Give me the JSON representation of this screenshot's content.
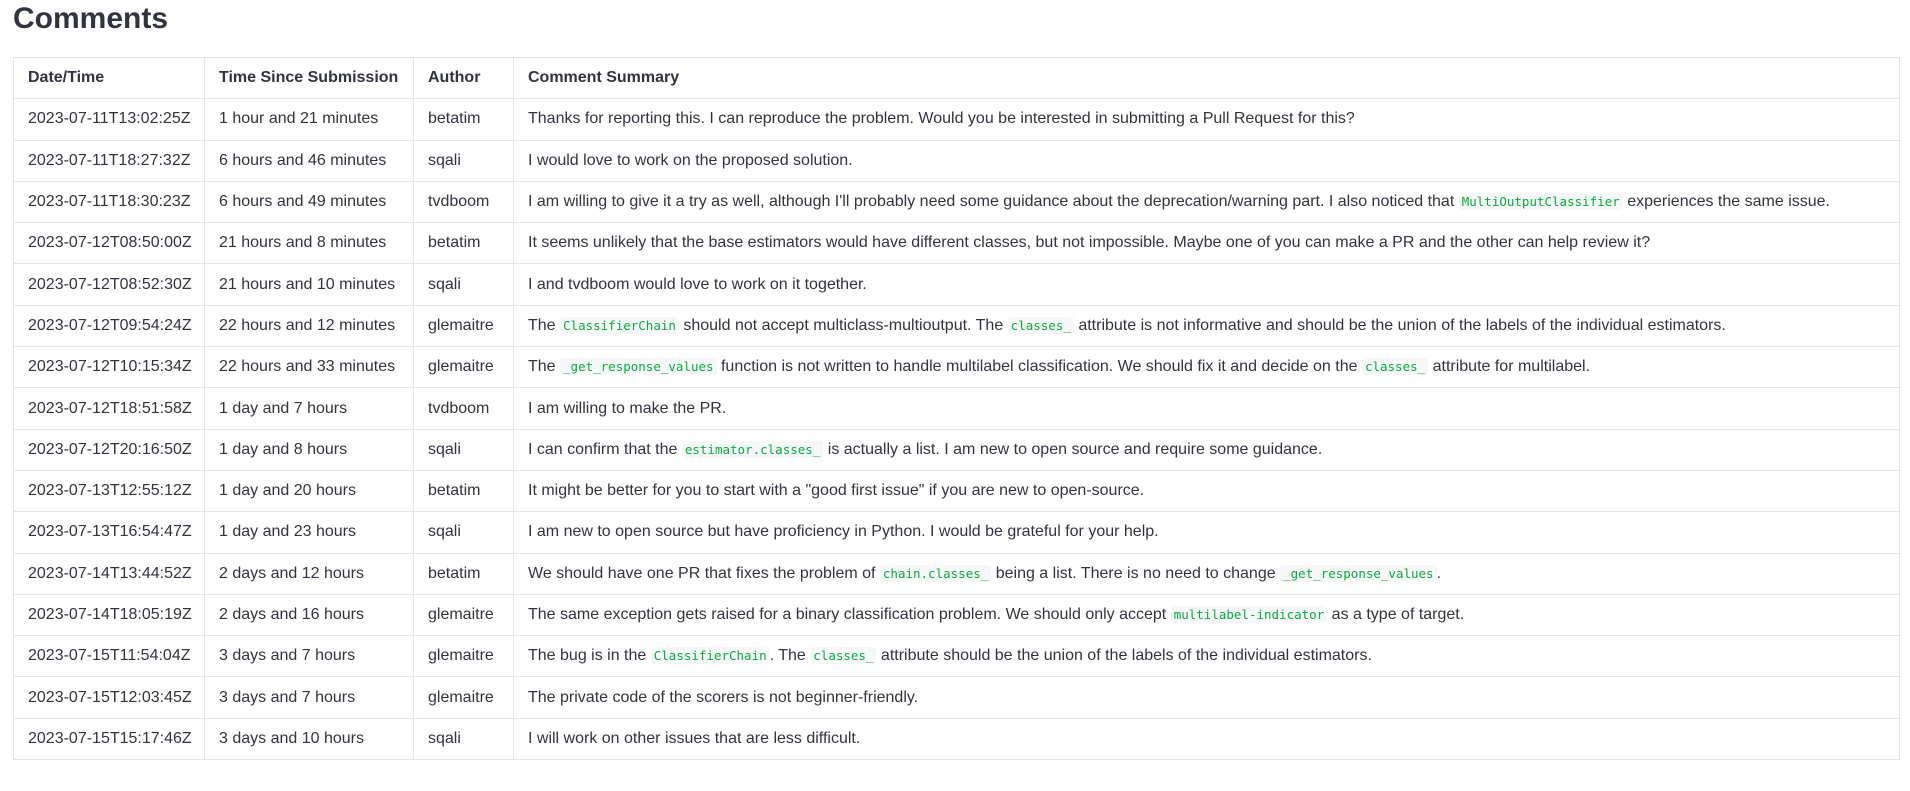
{
  "page": {
    "title": "Comments"
  },
  "table": {
    "columns": [
      "Date/Time",
      "Time Since Submission",
      "Author",
      "Comment Summary"
    ],
    "rows": [
      {
        "datetime": "2023-07-11T13:02:25Z",
        "since": "1 hour and 21 minutes",
        "author": "betatim",
        "summary": [
          {
            "t": "text",
            "v": "Thanks for reporting this. I can reproduce the problem. Would you be interested in submitting a Pull Request for this?"
          }
        ]
      },
      {
        "datetime": "2023-07-11T18:27:32Z",
        "since": "6 hours and 46 minutes",
        "author": "sqali",
        "summary": [
          {
            "t": "text",
            "v": "I would love to work on the proposed solution."
          }
        ]
      },
      {
        "datetime": "2023-07-11T18:30:23Z",
        "since": "6 hours and 49 minutes",
        "author": "tvdboom",
        "summary": [
          {
            "t": "text",
            "v": "I am willing to give it a try as well, although I'll probably need some guidance about the deprecation/warning part. I also noticed that "
          },
          {
            "t": "code",
            "v": "MultiOutputClassifier"
          },
          {
            "t": "text",
            "v": " experiences the same issue."
          }
        ]
      },
      {
        "datetime": "2023-07-12T08:50:00Z",
        "since": "21 hours and 8 minutes",
        "author": "betatim",
        "summary": [
          {
            "t": "text",
            "v": "It seems unlikely that the base estimators would have different classes, but not impossible. Maybe one of you can make a PR and the other can help review it?"
          }
        ]
      },
      {
        "datetime": "2023-07-12T08:52:30Z",
        "since": "21 hours and 10 minutes",
        "author": "sqali",
        "summary": [
          {
            "t": "text",
            "v": "I and tvdboom would love to work on it together."
          }
        ]
      },
      {
        "datetime": "2023-07-12T09:54:24Z",
        "since": "22 hours and 12 minutes",
        "author": "glemaitre",
        "summary": [
          {
            "t": "text",
            "v": "The "
          },
          {
            "t": "code",
            "v": "ClassifierChain"
          },
          {
            "t": "text",
            "v": " should not accept multiclass-multioutput. The "
          },
          {
            "t": "code",
            "v": "classes_"
          },
          {
            "t": "text",
            "v": " attribute is not informative and should be the union of the labels of the individual estimators."
          }
        ]
      },
      {
        "datetime": "2023-07-12T10:15:34Z",
        "since": "22 hours and 33 minutes",
        "author": "glemaitre",
        "summary": [
          {
            "t": "text",
            "v": "The "
          },
          {
            "t": "code",
            "v": "_get_response_values"
          },
          {
            "t": "text",
            "v": " function is not written to handle multilabel classification. We should fix it and decide on the "
          },
          {
            "t": "code",
            "v": "classes_"
          },
          {
            "t": "text",
            "v": " attribute for multilabel."
          }
        ]
      },
      {
        "datetime": "2023-07-12T18:51:58Z",
        "since": "1 day and 7 hours",
        "author": "tvdboom",
        "summary": [
          {
            "t": "text",
            "v": "I am willing to make the PR."
          }
        ]
      },
      {
        "datetime": "2023-07-12T20:16:50Z",
        "since": "1 day and 8 hours",
        "author": "sqali",
        "summary": [
          {
            "t": "text",
            "v": "I can confirm that the "
          },
          {
            "t": "code",
            "v": "estimator.classes_"
          },
          {
            "t": "text",
            "v": " is actually a list. I am new to open source and require some guidance."
          }
        ]
      },
      {
        "datetime": "2023-07-13T12:55:12Z",
        "since": "1 day and 20 hours",
        "author": "betatim",
        "summary": [
          {
            "t": "text",
            "v": "It might be better for you to start with a \"good first issue\" if you are new to open-source."
          }
        ]
      },
      {
        "datetime": "2023-07-13T16:54:47Z",
        "since": "1 day and 23 hours",
        "author": "sqali",
        "summary": [
          {
            "t": "text",
            "v": "I am new to open source but have proficiency in Python. I would be grateful for your help."
          }
        ]
      },
      {
        "datetime": "2023-07-14T13:44:52Z",
        "since": "2 days and 12 hours",
        "author": "betatim",
        "summary": [
          {
            "t": "text",
            "v": "We should have one PR that fixes the problem of "
          },
          {
            "t": "code",
            "v": "chain.classes_"
          },
          {
            "t": "text",
            "v": " being a list. There is no need to change "
          },
          {
            "t": "code",
            "v": "_get_response_values"
          },
          {
            "t": "text",
            "v": "."
          }
        ]
      },
      {
        "datetime": "2023-07-14T18:05:19Z",
        "since": "2 days and 16 hours",
        "author": "glemaitre",
        "summary": [
          {
            "t": "text",
            "v": "The same exception gets raised for a binary classification problem. We should only accept "
          },
          {
            "t": "code",
            "v": "multilabel-indicator"
          },
          {
            "t": "text",
            "v": " as a type of target."
          }
        ]
      },
      {
        "datetime": "2023-07-15T11:54:04Z",
        "since": "3 days and 7 hours",
        "author": "glemaitre",
        "summary": [
          {
            "t": "text",
            "v": "The bug is in the "
          },
          {
            "t": "code",
            "v": "ClassifierChain"
          },
          {
            "t": "text",
            "v": ". The "
          },
          {
            "t": "code",
            "v": "classes_"
          },
          {
            "t": "text",
            "v": " attribute should be the union of the labels of the individual estimators."
          }
        ]
      },
      {
        "datetime": "2023-07-15T12:03:45Z",
        "since": "3 days and 7 hours",
        "author": "glemaitre",
        "summary": [
          {
            "t": "text",
            "v": "The private code of the scorers is not beginner-friendly."
          }
        ]
      },
      {
        "datetime": "2023-07-15T15:17:46Z",
        "since": "3 days and 10 hours",
        "author": "sqali",
        "summary": [
          {
            "t": "text",
            "v": "I will work on other issues that are less difficult."
          }
        ]
      }
    ]
  }
}
